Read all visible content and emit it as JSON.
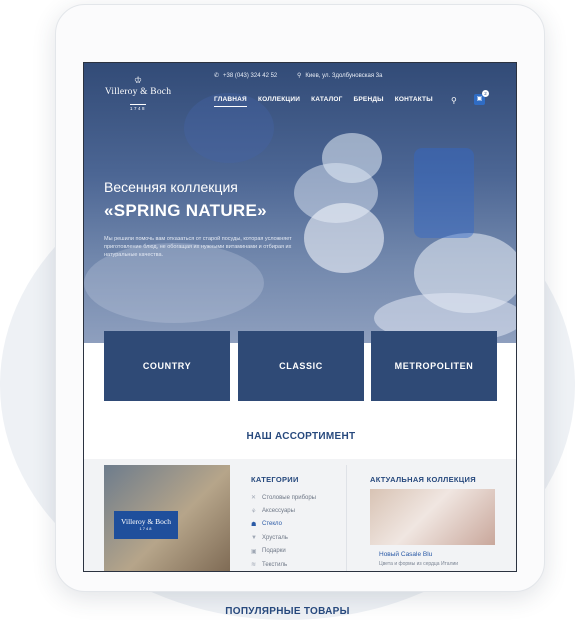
{
  "header": {
    "phone": "+38 (043) 324 42 52",
    "address": "Киев, ул. Здолбуновская 3а",
    "logo": {
      "name": "Villeroy & Boch",
      "year": "1748"
    },
    "nav": [
      "ГЛАВНАЯ",
      "КОЛЛЕКЦИИ",
      "КАТАЛОГ",
      "БРЕНДЫ",
      "КОНТАКТЫ"
    ],
    "cart_count": "2"
  },
  "hero": {
    "subtitle": "Весенняя коллекция",
    "title": "«SPRING NATURE»",
    "text": "Мы решили помочь вам отказаться от старой посуды, которая усложняет приготовление блюд, не обогащая их нужными витаминами и отбирая их натуральные качества."
  },
  "categories": [
    "COUNTRY",
    "CLASSIC",
    "METROPOLITEN"
  ],
  "assortment": {
    "title": "НАШ АССОРТИМЕНТ",
    "categories_title": "КАТЕГОРИИ",
    "categories_list": [
      "Столовые приборы",
      "Аксессуары",
      "Стекло",
      "Хрусталь",
      "Подарки",
      "Текстиль"
    ],
    "collection_title": "АКТУАЛЬНАЯ КОЛЛЕКЦИЯ",
    "collection_name": "Новый Casale Blu",
    "collection_desc": "Цвета и формы из сердца Италии"
  },
  "popular_title": "ПОПУЛЯРНЫЕ ТОВАРЫ",
  "icons": [
    "phone-icon",
    "location-icon",
    "search-icon",
    "cart-icon",
    "cutlery-icon",
    "accessory-icon",
    "glass-icon",
    "crystal-icon",
    "gift-icon",
    "textile-icon"
  ],
  "colors": {
    "brand_blue": "#27497d",
    "accent_blue": "#2a5aa6",
    "hero_overlay": "#324b77"
  }
}
